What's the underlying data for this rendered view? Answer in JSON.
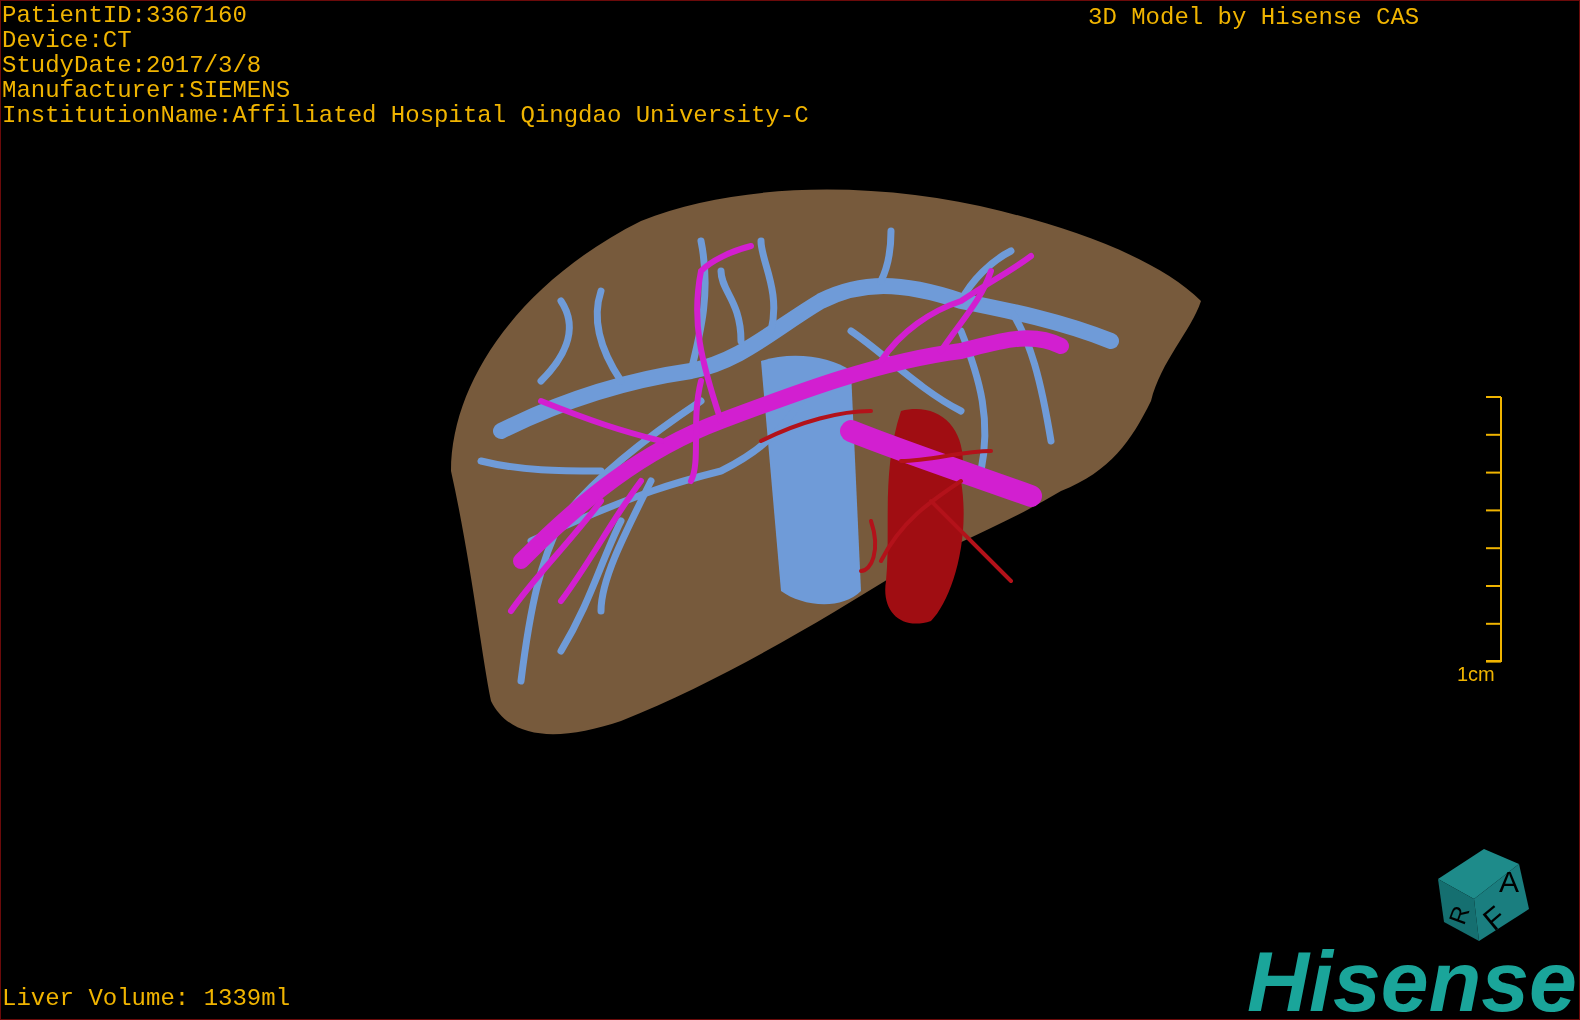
{
  "viewport": {
    "info_lines": [
      "PatientID:3367160",
      "Device:CT",
      "StudyDate:2017/3/8",
      "Manufacturer:SIEMENS",
      "InstitutionName:Affiliated Hospital Qingdao University-C"
    ],
    "title": "3D Model by Hisense CAS",
    "volume": "Liver Volume: 1339ml",
    "scale_bar": {
      "label": "1cm"
    },
    "orientation_cube": {
      "faces": [
        "A",
        "R",
        "F"
      ]
    },
    "logo": "Hisense"
  }
}
